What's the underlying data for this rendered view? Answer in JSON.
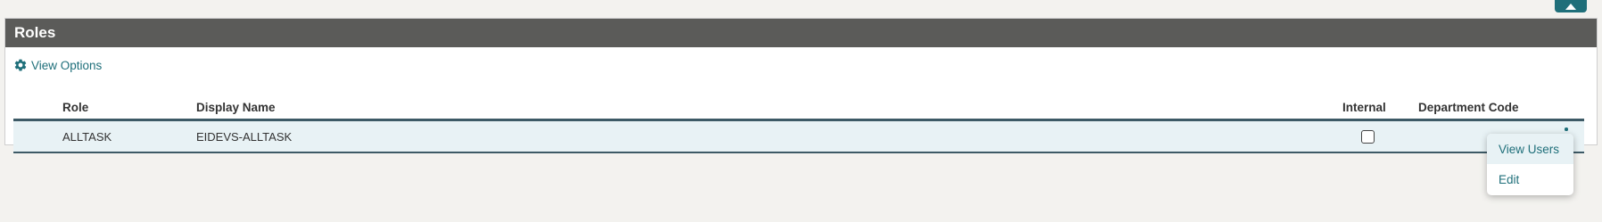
{
  "panel": {
    "title": "Roles"
  },
  "view_options": {
    "label": "View Options",
    "icon": "gear-icon"
  },
  "table": {
    "columns": {
      "role": "Role",
      "display_name": "Display Name",
      "internal": "Internal",
      "department_code": "Department Code"
    },
    "rows": [
      {
        "role": "ALLTASK",
        "display_name": "EIDEVS-ALLTASK",
        "internal": false,
        "department_code": ""
      }
    ]
  },
  "row_menu": {
    "items": [
      "View Users",
      "Edit"
    ]
  },
  "colors": {
    "header_bg": "#5b5b59",
    "accent": "#1f6f7a",
    "row_bg": "#e8f2f5",
    "page_bg": "#f3f2ef"
  }
}
